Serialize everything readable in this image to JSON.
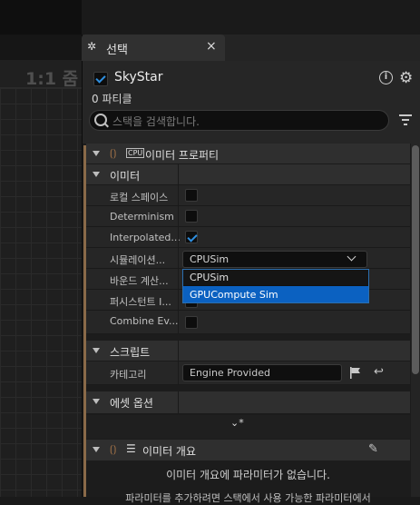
{
  "viewport": {
    "zoom_label": "1:1 줌"
  },
  "tab": {
    "title": "선택",
    "close": "×"
  },
  "emitter": {
    "name": "SkyStar",
    "enabled": true,
    "particle_count": "0 파티클"
  },
  "search": {
    "placeholder": "스택을 검색합니다."
  },
  "sections": {
    "emitter_properties": "이미터 프로퍼티",
    "emitter": "이미터",
    "script": "스크립트",
    "asset_options": "에셋 옵션",
    "emitter_overview": "이미터 개요"
  },
  "properties": [
    {
      "label": "로컬 스페이스",
      "checked": false
    },
    {
      "label": "Determinism",
      "checked": false
    },
    {
      "label": "Interpolated...",
      "checked": true
    },
    {
      "label": "시뮬레이션...",
      "value": "CPUSim"
    },
    {
      "label": "바운드 계산..."
    },
    {
      "label": "퍼시스턴트 I..."
    },
    {
      "label": "Combine Ev...",
      "checked": false
    }
  ],
  "sim_dropdown": {
    "selected": "CPUSim",
    "options": [
      "CPUSim",
      "GPUCompute Sim"
    ],
    "highlighted": "GPUCompute Sim"
  },
  "script": {
    "category_label": "카테고리",
    "category_value": "Engine Provided"
  },
  "overview": {
    "empty_message": "이미터 개요에 파라미터가 없습니다.",
    "hint": "파라미터를 추가하려면 스택에서 사용 가능한 파라미터에서"
  },
  "colors": {
    "accent": "#8a6a48",
    "selection": "#0b61c1",
    "check": "#2e8fe0"
  },
  "icons": {
    "tab": "niagara-icon",
    "info": "info-icon",
    "settings": "gear-icon",
    "search": "search-icon",
    "filter": "filter-icon"
  }
}
